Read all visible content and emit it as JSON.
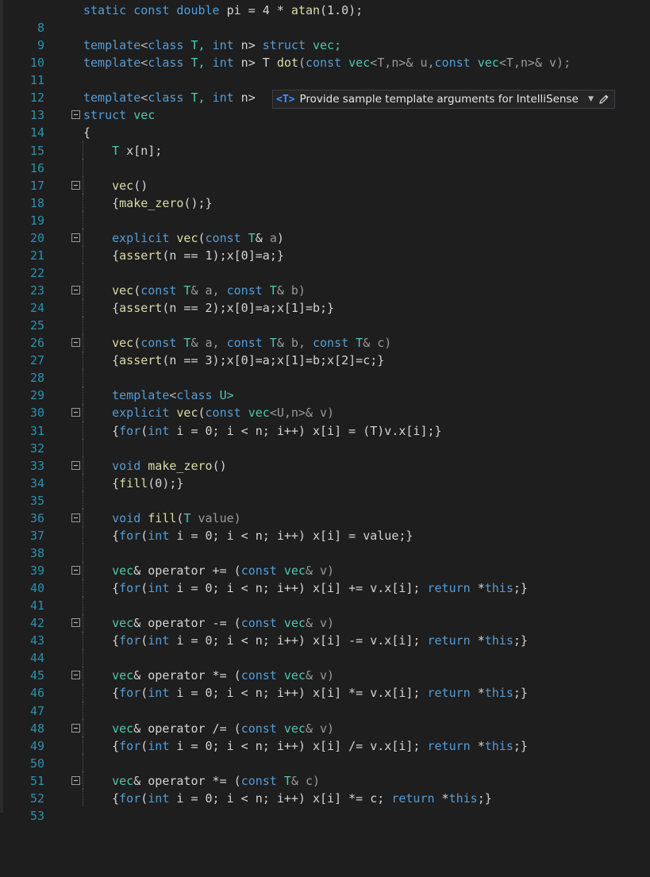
{
  "editor": {
    "lines": [
      {
        "n": "8"
      },
      {
        "n": "9"
      },
      {
        "n": "10"
      },
      {
        "n": "11"
      },
      {
        "n": "12"
      },
      {
        "n": "13"
      },
      {
        "n": "14"
      },
      {
        "n": "15"
      },
      {
        "n": "16"
      },
      {
        "n": "17"
      },
      {
        "n": "18"
      },
      {
        "n": "19"
      },
      {
        "n": "20"
      },
      {
        "n": "21"
      },
      {
        "n": "22"
      },
      {
        "n": "23"
      },
      {
        "n": "24"
      },
      {
        "n": "25"
      },
      {
        "n": "26"
      },
      {
        "n": "27"
      },
      {
        "n": "28"
      },
      {
        "n": "29"
      },
      {
        "n": "30"
      },
      {
        "n": "31"
      },
      {
        "n": "32"
      },
      {
        "n": "33"
      },
      {
        "n": "34"
      },
      {
        "n": "35"
      },
      {
        "n": "36"
      },
      {
        "n": "37"
      },
      {
        "n": "38"
      },
      {
        "n": "39"
      },
      {
        "n": "40"
      },
      {
        "n": "41"
      },
      {
        "n": "42"
      },
      {
        "n": "43"
      },
      {
        "n": "44"
      },
      {
        "n": "45"
      },
      {
        "n": "46"
      },
      {
        "n": "47"
      },
      {
        "n": "48"
      },
      {
        "n": "49"
      },
      {
        "n": "50"
      },
      {
        "n": "51"
      },
      {
        "n": "52"
      },
      {
        "n": "53"
      }
    ],
    "code": {
      "l8a": "static",
      "l8b": "const",
      "l8c": "double",
      "l8d": " pi = 4 * ",
      "l8e": "atan",
      "l8f": "(1.0);",
      "l10a": "template",
      "l10b": "<",
      "l10c": "class",
      "l10d": " T, ",
      "l10e": "int",
      "l10f": " n> ",
      "l10g": "struct",
      "l10h": " vec;",
      "l11a": "template",
      "l11b": "<",
      "l11c": "class",
      "l11d": " T, ",
      "l11e": "int",
      "l11f": " n> T ",
      "l11g": "dot",
      "l11h": "(",
      "l11i": "const",
      "l11j": " vec",
      "l11k": "<T,n>& u,",
      "l11l": "const",
      "l11m": " vec",
      "l11n": "<T,n>& v);",
      "l13a": "template",
      "l13b": "<",
      "l13c": "class",
      "l13d": " T, ",
      "l13e": "int",
      "l13f": " n>",
      "l14a": "struct",
      "l14b": " vec",
      "l15": "{",
      "l16a": "T",
      "l16b": " x[n];",
      "l18a": "vec",
      "l18b": "()",
      "l19a": "{",
      "l19b": "make_zero",
      "l19c": "();}",
      "l21a": "explicit",
      "l21b": " vec",
      "l21c": "(",
      "l21d": "const",
      "l21e": " T",
      "l21f": "& ",
      "l21g": "a",
      "l21h": ")",
      "l22a": "{",
      "l22b": "assert",
      "l22c": "(n == 1);x[0]=a;}",
      "l24a": "vec",
      "l24b": "(",
      "l24c": "const",
      "l24d": " T",
      "l24e": "& a, ",
      "l24f": "const",
      "l24g": " T",
      "l24h": "& b)",
      "l25a": "{",
      "l25b": "assert",
      "l25c": "(n == 2);x[0]=a;x[1]=b;}",
      "l27a": "vec",
      "l27b": "(",
      "l27c": "const",
      "l27d": " T",
      "l27e": "& a, ",
      "l27f": "const",
      "l27g": " T",
      "l27h": "& b, ",
      "l27i": "const",
      "l27j": " T",
      "l27k": "& c)",
      "l28a": "{",
      "l28b": "assert",
      "l28c": "(n == 3);x[0]=a;x[1]=b;x[2]=c;}",
      "l30a": "template",
      "l30b": "<",
      "l30c": "class",
      "l30d": " U>",
      "l31a": "explicit",
      "l31b": " vec",
      "l31c": "(",
      "l31d": "const",
      "l31e": " vec",
      "l31f": "<U,n>& v)",
      "l32a": "{",
      "l32b": "for",
      "l32c": "(",
      "l32d": "int",
      "l32e": " i = 0; i < n; i++) x[i] = (T)v.x[i];}",
      "l34a": "void",
      "l34b": " make_zero",
      "l34c": "()",
      "l35a": "{",
      "l35b": "fill",
      "l35c": "(0);}",
      "l37a": "void",
      "l37b": " fill",
      "l37c": "(",
      "l37d": "T",
      "l37e": " value)",
      "l38a": "{",
      "l38b": "for",
      "l38c": "(",
      "l38d": "int",
      "l38e": " i = 0; i < n; i++) x[i] = value;}",
      "l40a": "vec",
      "l40b": "& operator += (",
      "l40c": "const",
      "l40d": " vec",
      "l40e": "& v)",
      "l41a": "{",
      "l41b": "for",
      "l41c": "(",
      "l41d": "int",
      "l41e": " i = 0; i < n; i++) x[i] += v.x[i]; ",
      "l41f": "return",
      "l41g": " *",
      "l41h": "this",
      "l41i": ";}",
      "l43a": "vec",
      "l43b": "& operator -= (",
      "l43c": "const",
      "l43d": " vec",
      "l43e": "& v)",
      "l44a": "{",
      "l44b": "for",
      "l44c": "(",
      "l44d": "int",
      "l44e": " i = 0; i < n; i++) x[i] -= v.x[i]; ",
      "l44f": "return",
      "l44g": " *",
      "l44h": "this",
      "l44i": ";}",
      "l46a": "vec",
      "l46b": "& operator *= (",
      "l46c": "const",
      "l46d": " vec",
      "l46e": "& v)",
      "l47a": "{",
      "l47b": "for",
      "l47c": "(",
      "l47d": "int",
      "l47e": " i = 0; i < n; i++) x[i] *= v.x[i]; ",
      "l47f": "return",
      "l47g": " *",
      "l47h": "this",
      "l47i": ";}",
      "l49a": "vec",
      "l49b": "& operator /= (",
      "l49c": "const",
      "l49d": " vec",
      "l49e": "& v)",
      "l50a": "{",
      "l50b": "for",
      "l50c": "(",
      "l50d": "int",
      "l50e": " i = 0; i < n; i++) x[i] /= v.x[i]; ",
      "l50f": "return",
      "l50g": " *",
      "l50h": "this",
      "l50i": ";}",
      "l52a": "vec",
      "l52b": "& operator *= (",
      "l52c": "const",
      "l52d": " T",
      "l52e": "& c)",
      "l53a": "{",
      "l53b": "for",
      "l53c": "(",
      "l53d": "int",
      "l53e": " i = 0; i < n; i++) x[i] *= c; ",
      "l53f": "return",
      "l53g": " *",
      "l53h": "this",
      "l53i": ";}"
    }
  },
  "intellisense_hint": {
    "badge": "<T>",
    "text": "Provide sample template arguments for IntelliSense",
    "dropdown_icon": "chevron-down-icon",
    "edit_icon": "pencil-icon"
  },
  "colors": {
    "background": "#1e1e1e",
    "line_numbers": "#2b91af",
    "keyword": "#569cd6",
    "type": "#4ec9b0",
    "function": "#dcdcaa",
    "number": "#b5cea8"
  }
}
